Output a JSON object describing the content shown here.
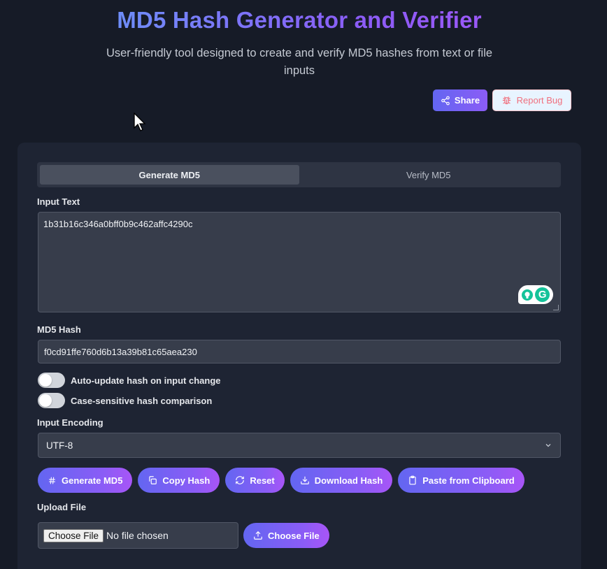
{
  "header": {
    "title": "MD5 Hash Generator and Verifier",
    "subtitle": "User-friendly tool designed to create and verify MD5 hashes from text or file inputs",
    "share_label": "Share",
    "report_bug_label": "Report Bug"
  },
  "tabs": [
    {
      "label": "Generate MD5",
      "active": true
    },
    {
      "label": "Verify MD5",
      "active": false
    }
  ],
  "input_text": {
    "label": "Input Text",
    "value": "1b31b16c346a0bff0b9c462affc4290c"
  },
  "md5_hash": {
    "label": "MD5 Hash",
    "value": "f0cd91ffe760d6b13a39b81c65aea230"
  },
  "toggles": [
    {
      "label": "Auto-update hash on input change",
      "on": false
    },
    {
      "label": "Case-sensitive hash comparison",
      "on": false
    }
  ],
  "encoding": {
    "label": "Input Encoding",
    "selected": "UTF-8"
  },
  "actions": {
    "generate": "Generate MD5",
    "copy": "Copy Hash",
    "reset": "Reset",
    "download": "Download Hash",
    "paste": "Paste from Clipboard"
  },
  "upload": {
    "label": "Upload File",
    "native_button": "Choose File",
    "status": "No file chosen",
    "choose_button": "Choose File"
  },
  "colors": {
    "background": "#161b27",
    "card": "#1e2433",
    "accent_start": "#6366f1",
    "accent_end": "#a855f7",
    "bug_text": "#f0707e"
  }
}
